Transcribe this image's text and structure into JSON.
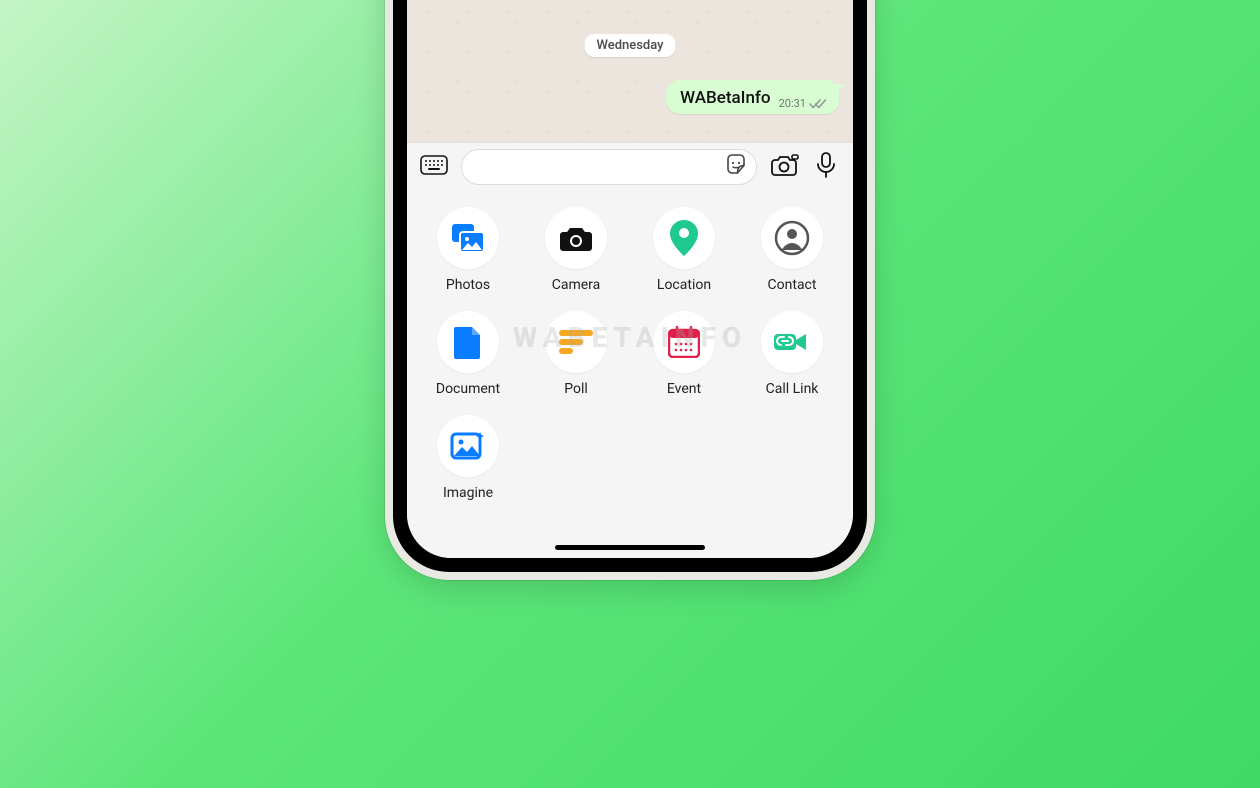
{
  "chat": {
    "date_label": "Wednesday",
    "last_message": {
      "text": "WABetaInfo",
      "time": "20:31",
      "status": "read"
    }
  },
  "input_bar": {
    "placeholder": ""
  },
  "attachments": {
    "items": [
      {
        "id": "photos",
        "label": "Photos",
        "icon": "photos-icon",
        "color": "#0a7cff"
      },
      {
        "id": "camera",
        "label": "Camera",
        "icon": "camera-icon",
        "color": "#111111"
      },
      {
        "id": "location",
        "label": "Location",
        "icon": "location-icon",
        "color": "#1fc98f"
      },
      {
        "id": "contact",
        "label": "Contact",
        "icon": "contact-icon",
        "color": "#555555"
      },
      {
        "id": "document",
        "label": "Document",
        "icon": "document-icon",
        "color": "#0a7cff"
      },
      {
        "id": "poll",
        "label": "Poll",
        "icon": "poll-icon",
        "color": "#f5a623"
      },
      {
        "id": "event",
        "label": "Event",
        "icon": "event-icon",
        "color": "#e0204a"
      },
      {
        "id": "calllink",
        "label": "Call Link",
        "icon": "calllink-icon",
        "color": "#1fc98f"
      },
      {
        "id": "imagine",
        "label": "Imagine",
        "icon": "imagine-icon",
        "color": "#0a7cff"
      }
    ]
  },
  "watermark": "WABETAINFO"
}
